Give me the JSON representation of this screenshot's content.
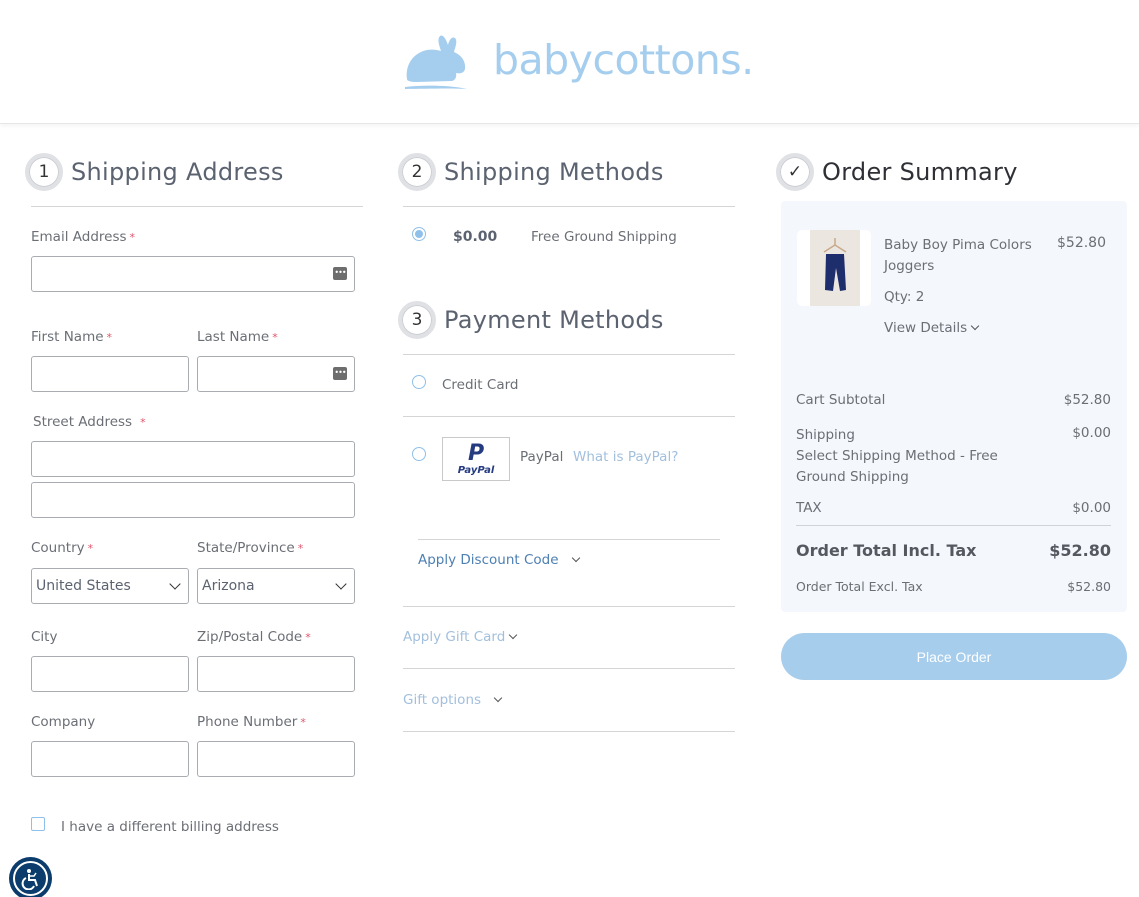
{
  "brand": {
    "name": "babycottons.",
    "logo_icon": "bunny-icon",
    "color": "#a5cdee"
  },
  "colors": {
    "accent_light": "#a6cdec",
    "link": "#a2bfdc",
    "link_dark": "#4d7fb2",
    "required": "#e0566b",
    "summary_bg": "#f4f8fd"
  },
  "shipping_address": {
    "step": "1",
    "title": "Shipping Address",
    "fields": {
      "email": {
        "label": "Email Address",
        "value": "",
        "required": true
      },
      "first_name": {
        "label": "First Name",
        "value": "",
        "required": true
      },
      "last_name": {
        "label": "Last Name",
        "value": "",
        "required": true
      },
      "street": {
        "label": "Street Address",
        "line1": "",
        "line2": "",
        "required": true
      },
      "country": {
        "label": "Country",
        "value": "United States",
        "required": true
      },
      "state": {
        "label": "State/Province",
        "value": "Arizona",
        "required": true
      },
      "city": {
        "label": "City",
        "value": ""
      },
      "zip": {
        "label": "Zip/Postal Code",
        "value": "",
        "required": true
      },
      "company": {
        "label": "Company",
        "value": ""
      },
      "phone": {
        "label": "Phone Number",
        "value": "",
        "required": true
      }
    },
    "required_mark": "*",
    "billing_checkbox": {
      "label": "I have a different billing address",
      "checked": false
    }
  },
  "shipping_methods": {
    "step": "2",
    "title": "Shipping Methods",
    "options": [
      {
        "price": "$0.00",
        "label": "Free Ground Shipping",
        "selected": true
      }
    ]
  },
  "payment_methods": {
    "step": "3",
    "title": "Payment Methods",
    "options": [
      {
        "label": "Credit Card",
        "selected": false
      },
      {
        "label": "PayPal",
        "logo_text": "PayPal",
        "help_link": "What is PayPal?",
        "selected": false
      }
    ],
    "discount": "Apply Discount Code",
    "gift_card": "Apply Gift Card",
    "gift_options": "Gift options"
  },
  "order_summary": {
    "step_icon": "✓",
    "title": "Order Summary",
    "items": [
      {
        "name": "Baby Boy Pima Colors Joggers",
        "price": "$52.80",
        "qty": "Qty: 2",
        "details_link": "View Details"
      }
    ],
    "subtotal": {
      "label": "Cart Subtotal",
      "value": "$52.80"
    },
    "shipping": {
      "label": "Shipping",
      "method": "Select Shipping Method - Free Ground Shipping",
      "value": "$0.00"
    },
    "tax": {
      "label": "TAX",
      "value": "$0.00"
    },
    "total_incl": {
      "label": "Order Total Incl. Tax",
      "value": "$52.80"
    },
    "total_excl": {
      "label": "Order Total Excl. Tax",
      "value": "$52.80"
    },
    "place_order": "Place Order"
  },
  "accessibility": {
    "icon": "wheelchair-icon"
  }
}
